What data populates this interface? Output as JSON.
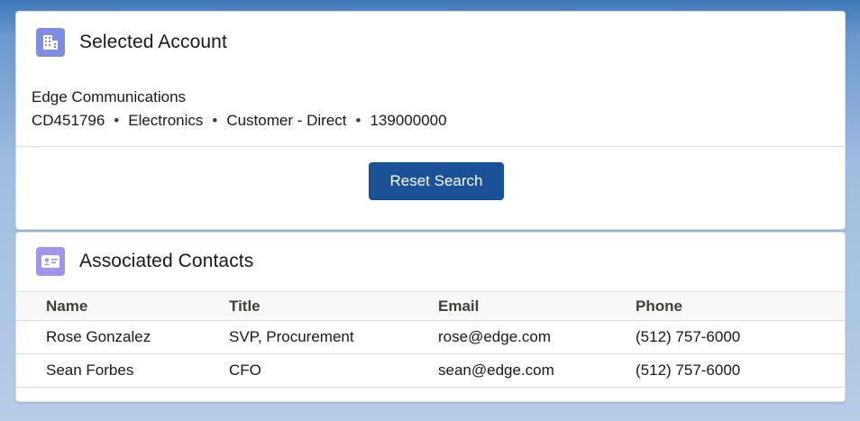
{
  "account_card": {
    "title": "Selected Account",
    "icon": "building-icon",
    "account_name": "Edge Communications",
    "account_number": "CD451796",
    "industry": "Electronics",
    "type": "Customer - Direct",
    "annual_revenue": "139000000",
    "separator": "•",
    "reset_button_label": "Reset Search"
  },
  "contacts_card": {
    "title": "Associated Contacts",
    "icon": "contact-card-icon",
    "columns": [
      "Name",
      "Title",
      "Email",
      "Phone"
    ],
    "rows": [
      {
        "name": "Rose Gonzalez",
        "title": "SVP, Procurement",
        "email": "rose@edge.com",
        "phone": "(512) 757-6000"
      },
      {
        "name": "Sean Forbes",
        "title": "CFO",
        "email": "sean@edge.com",
        "phone": "(512) 757-6000"
      }
    ]
  },
  "colors": {
    "account_icon_bg": "#7f8de1",
    "contacts_icon_bg": "#a094ed",
    "brand_button": "#1b5297"
  }
}
